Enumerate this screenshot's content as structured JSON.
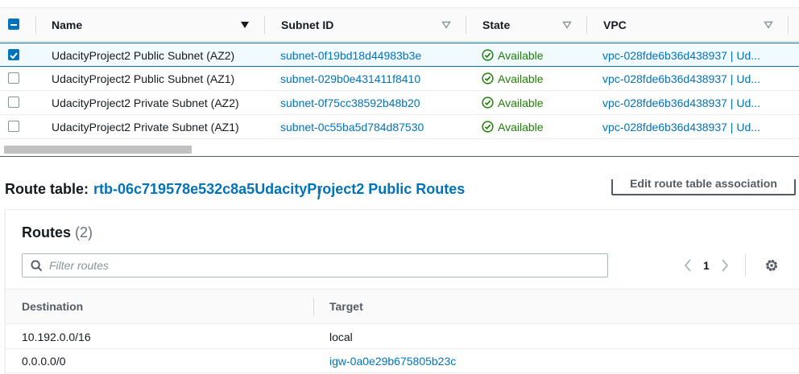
{
  "subnet_table": {
    "columns": {
      "name": "Name",
      "subnet_id": "Subnet ID",
      "state": "State",
      "vpc": "VPC"
    },
    "rows": [
      {
        "selected": true,
        "name": "UdacityProject2 Public Subnet (AZ2)",
        "subnet_id": "subnet-0f19bd18d44983b3e",
        "state": "Available",
        "vpc": "vpc-028fde6b36d438937 | Ud..."
      },
      {
        "selected": false,
        "name": "UdacityProject2 Public Subnet (AZ1)",
        "subnet_id": "subnet-029b0e431411f8410",
        "state": "Available",
        "vpc": "vpc-028fde6b36d438937 | Ud..."
      },
      {
        "selected": false,
        "name": "UdacityProject2 Private Subnet (AZ2)",
        "subnet_id": "subnet-0f75cc38592b48b20",
        "state": "Available",
        "vpc": "vpc-028fde6b36d438937 | Ud..."
      },
      {
        "selected": false,
        "name": "UdacityProject2 Private Subnet (AZ1)",
        "subnet_id": "subnet-0c55ba5d784d87530",
        "state": "Available",
        "vpc": "vpc-028fde6b36d438937 | Ud..."
      }
    ]
  },
  "route_panel": {
    "title_prefix": "Route table:",
    "route_table_id": "rtb-06c719578e532c8a5",
    "separator": "/",
    "route_table_name": "UdacityProject2 Public Routes",
    "edit_button": "Edit route table association",
    "routes": {
      "heading": "Routes",
      "count": "(2)",
      "filter_placeholder": "Filter routes",
      "current_page": "1",
      "columns": {
        "destination": "Destination",
        "target": "Target"
      },
      "rows": [
        {
          "destination": "10.192.0.0/16",
          "target": "local",
          "target_is_link": false
        },
        {
          "destination": "0.0.0.0/0",
          "target": "igw-0a0e29b675805b23c",
          "target_is_link": true
        }
      ]
    }
  },
  "colors": {
    "link": "#0073bb",
    "success": "#1d8102",
    "selected_row_bg": "#f1faff",
    "selected_border": "#0073bb"
  },
  "icons": [
    "checkbox-minus-icon",
    "sort-descending-icon",
    "sort-caret-icon",
    "status-ok-icon",
    "search-icon",
    "chevron-left-icon",
    "chevron-right-icon",
    "gear-icon",
    "drag-handle-icon",
    "panel-position-icon"
  ]
}
